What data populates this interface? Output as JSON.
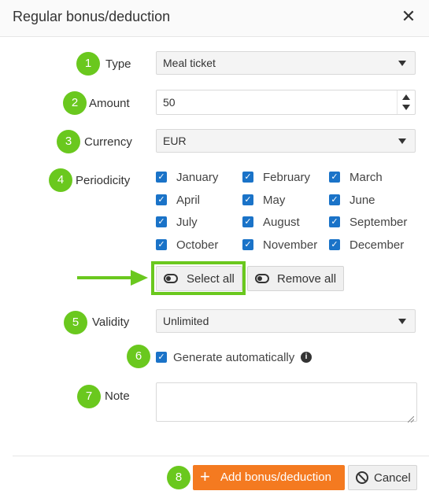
{
  "dialog": {
    "title": "Regular bonus/deduction",
    "close_symbol": "✕"
  },
  "form": {
    "type": {
      "step": "1",
      "label": "Type",
      "value": "Meal ticket"
    },
    "amount": {
      "step": "2",
      "label": "Amount",
      "value": "50"
    },
    "currency": {
      "step": "3",
      "label": "Currency",
      "value": "EUR"
    },
    "periodicity": {
      "step": "4",
      "label": "Periodicity",
      "months": [
        {
          "label": "January",
          "checked": true
        },
        {
          "label": "February",
          "checked": true
        },
        {
          "label": "March",
          "checked": true
        },
        {
          "label": "April",
          "checked": true
        },
        {
          "label": "May",
          "checked": true
        },
        {
          "label": "June",
          "checked": true
        },
        {
          "label": "July",
          "checked": true
        },
        {
          "label": "August",
          "checked": true
        },
        {
          "label": "September",
          "checked": true
        },
        {
          "label": "October",
          "checked": true
        },
        {
          "label": "November",
          "checked": true
        },
        {
          "label": "December",
          "checked": true
        }
      ],
      "select_all_label": "Select all",
      "remove_all_label": "Remove all"
    },
    "validity": {
      "step": "5",
      "label": "Validity",
      "value": "Unlimited"
    },
    "generate": {
      "step": "6",
      "label": "Generate automatically",
      "checked": true,
      "info_symbol": "i"
    },
    "note": {
      "step": "7",
      "label": "Note",
      "value": ""
    }
  },
  "footer": {
    "step": "8",
    "add_label": "Add bonus/deduction",
    "cancel_label": "Cancel"
  },
  "colors": {
    "badge": "#6ac81e",
    "primary": "#f47a20",
    "checkbox": "#1a73c8"
  },
  "icons": [
    "close-icon",
    "chevron-down-icon",
    "toggle-icon",
    "info-icon",
    "plus-icon",
    "ban-icon",
    "arrow-icon"
  ]
}
